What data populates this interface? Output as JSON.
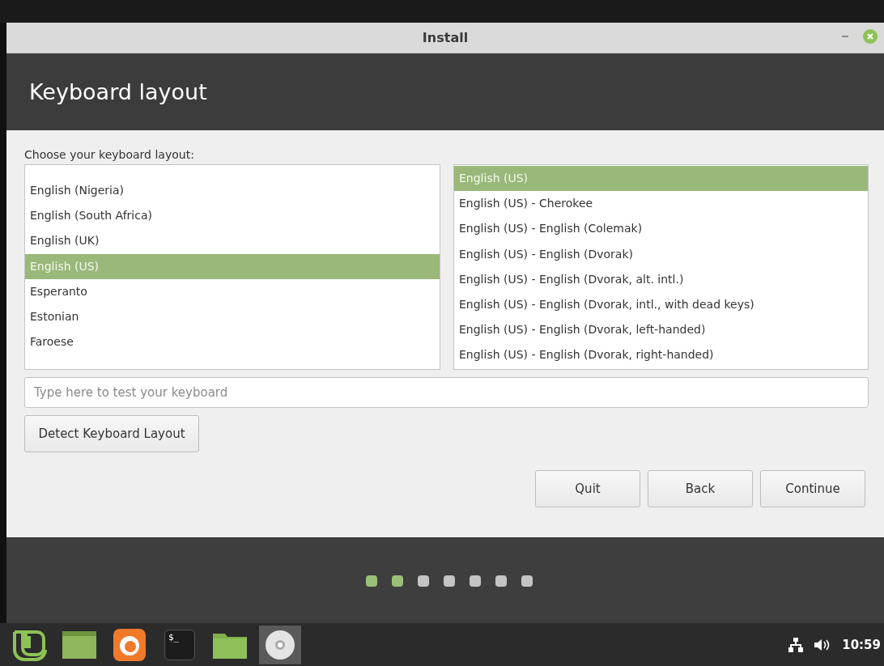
{
  "window": {
    "title": "Install"
  },
  "header": {
    "title": "Keyboard layout"
  },
  "prompt": "Choose your keyboard layout:",
  "layouts": [
    {
      "label": "English (Nigeria)",
      "selected": false
    },
    {
      "label": "English (South Africa)",
      "selected": false
    },
    {
      "label": "English (UK)",
      "selected": false
    },
    {
      "label": "English (US)",
      "selected": true
    },
    {
      "label": "Esperanto",
      "selected": false
    },
    {
      "label": "Estonian",
      "selected": false
    },
    {
      "label": "Faroese",
      "selected": false
    }
  ],
  "variants": [
    {
      "label": "English (US)",
      "selected": true
    },
    {
      "label": "English (US) - Cherokee",
      "selected": false
    },
    {
      "label": "English (US) - English (Colemak)",
      "selected": false
    },
    {
      "label": "English (US) - English (Dvorak)",
      "selected": false
    },
    {
      "label": "English (US) - English (Dvorak, alt. intl.)",
      "selected": false
    },
    {
      "label": "English (US) - English (Dvorak, intl., with dead keys)",
      "selected": false
    },
    {
      "label": "English (US) - English (Dvorak, left-handed)",
      "selected": false
    },
    {
      "label": "English (US) - English (Dvorak, right-handed)",
      "selected": false
    }
  ],
  "test_field": {
    "placeholder": "Type here to test your keyboard"
  },
  "detect_button": "Detect Keyboard Layout",
  "buttons": [
    "Quit",
    "Back",
    "Continue"
  ],
  "steps": [
    {
      "done": true
    },
    {
      "done": true
    },
    {
      "done": false
    },
    {
      "done": false
    },
    {
      "done": false
    },
    {
      "done": false
    },
    {
      "done": false
    }
  ],
  "taskbar": {
    "items": [
      {
        "kind": "menu",
        "selected": false
      },
      {
        "kind": "desktop",
        "selected": false
      },
      {
        "kind": "browser",
        "selected": false
      },
      {
        "kind": "terminal",
        "glyph": "$_",
        "selected": false
      },
      {
        "kind": "folder",
        "selected": false
      },
      {
        "kind": "disc",
        "selected": true
      }
    ],
    "clock": "10:59"
  }
}
